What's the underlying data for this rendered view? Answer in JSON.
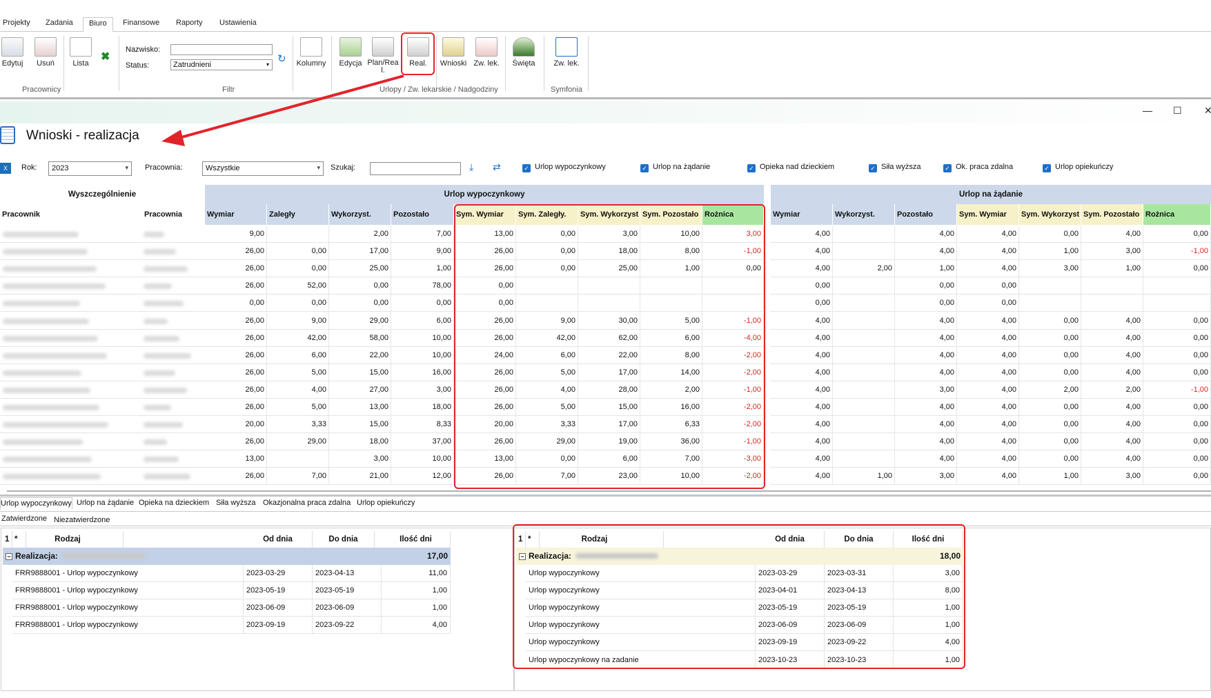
{
  "ribbon": {
    "tabs": [
      "Projekty",
      "Zadania",
      "Biuro",
      "Finansowe",
      "Raporty",
      "Ustawienia"
    ],
    "buttons": {
      "edytuj": "Edytuj",
      "usun": "Usuń",
      "lista": "Lista",
      "kolumny": "Kolumny",
      "edycja": "Edycja",
      "plan": "Plan/Rea l.",
      "real": "Real.",
      "wnioski": "Wnioski",
      "zwlek": "Zw. lek.",
      "swieta": "Święta",
      "zwlek2": "Zw. lek."
    },
    "filters": {
      "nazwisko_label": "Nazwisko:",
      "status_label": "Status:",
      "status_value": "Zatrudnieni",
      "nazwisko_value": ""
    },
    "groups": {
      "pracownicy": "Pracownicy",
      "filtr": "Filtr",
      "urlopy": "Urlopy / Zw. lekarskie / Nadgodziny",
      "symfonia": "Symfonia"
    }
  },
  "window": {
    "title": "Wnioski - realizacja"
  },
  "filterbar": {
    "rok_label": "Rok:",
    "rok_value": "2023",
    "pracownia_label": "Pracownia:",
    "pracownia_value": "Wszystkie",
    "szukaj_label": "Szukaj:",
    "szukaj_value": "",
    "checkboxes": [
      "Urlop wypoczynkowy",
      "Urlop na żądanie",
      "Opieka nad dzieckiem",
      "Siła wyższa",
      "Ok. praca zdalna",
      "Urlop opiekuńczy"
    ]
  },
  "grid": {
    "group_headers": {
      "wyszczegolnienie": "Wyszczególnienie",
      "urlop": "Urlop wypoczynkowy",
      "zadanie": "Urlop na żądanie"
    },
    "columns": {
      "pracownik": "Pracownik",
      "pracownia": "Pracownia",
      "urlop": [
        "Wymiar",
        "Zaległy",
        "Wykorzyst.",
        "Pozostało",
        "Sym. Wymiar",
        "Sym. Zaległy.",
        "Sym. Wykorzyst",
        "Sym. Pozostało",
        "Rożnica"
      ],
      "zadanie": [
        "Wymiar",
        "Wykorzyst.",
        "Pozostało",
        "Sym. Wymiar",
        "Sym. Wykorzyst",
        "Sym. Pozostało",
        "Rożnica"
      ]
    },
    "rows": [
      {
        "u": [
          "9,00",
          "",
          "2,00",
          "7,00",
          "13,00",
          "0,00",
          "3,00",
          "10,00",
          "3,00"
        ],
        "z": [
          "4,00",
          "",
          "4,00",
          "4,00",
          "0,00",
          "4,00",
          "0,00"
        ]
      },
      {
        "u": [
          "26,00",
          "0,00",
          "17,00",
          "9,00",
          "26,00",
          "0,00",
          "18,00",
          "8,00",
          "-1,00"
        ],
        "z": [
          "4,00",
          "",
          "4,00",
          "4,00",
          "1,00",
          "3,00",
          "-1,00"
        ]
      },
      {
        "u": [
          "26,00",
          "0,00",
          "25,00",
          "1,00",
          "26,00",
          "0,00",
          "25,00",
          "1,00",
          "0,00"
        ],
        "z": [
          "4,00",
          "2,00",
          "1,00",
          "4,00",
          "3,00",
          "1,00",
          "0,00"
        ]
      },
      {
        "u": [
          "26,00",
          "52,00",
          "0,00",
          "78,00",
          "0,00",
          "",
          "",
          "",
          ""
        ],
        "z": [
          "0,00",
          "",
          "0,00",
          "0,00",
          "",
          "",
          ""
        ]
      },
      {
        "u": [
          "0,00",
          "0,00",
          "0,00",
          "0,00",
          "0,00",
          "",
          "",
          "",
          ""
        ],
        "z": [
          "0,00",
          "",
          "0,00",
          "0,00",
          "",
          "",
          ""
        ]
      },
      {
        "u": [
          "26,00",
          "9,00",
          "29,00",
          "6,00",
          "26,00",
          "9,00",
          "30,00",
          "5,00",
          "-1,00"
        ],
        "z": [
          "4,00",
          "",
          "4,00",
          "4,00",
          "0,00",
          "4,00",
          "0,00"
        ]
      },
      {
        "u": [
          "26,00",
          "42,00",
          "58,00",
          "10,00",
          "26,00",
          "42,00",
          "62,00",
          "6,00",
          "-4,00"
        ],
        "z": [
          "4,00",
          "",
          "4,00",
          "4,00",
          "0,00",
          "4,00",
          "0,00"
        ]
      },
      {
        "u": [
          "26,00",
          "6,00",
          "22,00",
          "10,00",
          "24,00",
          "6,00",
          "22,00",
          "8,00",
          "-2,00"
        ],
        "z": [
          "4,00",
          "",
          "4,00",
          "4,00",
          "0,00",
          "4,00",
          "0,00"
        ]
      },
      {
        "u": [
          "26,00",
          "5,00",
          "15,00",
          "16,00",
          "26,00",
          "5,00",
          "17,00",
          "14,00",
          "-2,00"
        ],
        "z": [
          "4,00",
          "",
          "4,00",
          "4,00",
          "0,00",
          "4,00",
          "0,00"
        ]
      },
      {
        "u": [
          "26,00",
          "4,00",
          "27,00",
          "3,00",
          "26,00",
          "4,00",
          "28,00",
          "2,00",
          "-1,00"
        ],
        "z": [
          "4,00",
          "",
          "3,00",
          "4,00",
          "2,00",
          "2,00",
          "-1,00"
        ]
      },
      {
        "u": [
          "26,00",
          "5,00",
          "13,00",
          "18,00",
          "26,00",
          "5,00",
          "15,00",
          "16,00",
          "-2,00"
        ],
        "z": [
          "4,00",
          "",
          "4,00",
          "4,00",
          "0,00",
          "4,00",
          "0,00"
        ]
      },
      {
        "u": [
          "20,00",
          "3,33",
          "15,00",
          "8,33",
          "20,00",
          "3,33",
          "17,00",
          "6,33",
          "-2,00"
        ],
        "z": [
          "4,00",
          "",
          "4,00",
          "4,00",
          "0,00",
          "4,00",
          "0,00"
        ]
      },
      {
        "u": [
          "26,00",
          "29,00",
          "18,00",
          "37,00",
          "26,00",
          "29,00",
          "19,00",
          "36,00",
          "-1,00"
        ],
        "z": [
          "4,00",
          "",
          "4,00",
          "4,00",
          "0,00",
          "4,00",
          "0,00"
        ]
      },
      {
        "u": [
          "13,00",
          "",
          "3,00",
          "10,00",
          "13,00",
          "0,00",
          "6,00",
          "7,00",
          "-3,00"
        ],
        "z": [
          "4,00",
          "",
          "4,00",
          "4,00",
          "0,00",
          "4,00",
          "0,00"
        ]
      },
      {
        "u": [
          "26,00",
          "7,00",
          "21,00",
          "12,00",
          "26,00",
          "7,00",
          "23,00",
          "10,00",
          "-2,00"
        ],
        "z": [
          "4,00",
          "1,00",
          "3,00",
          "4,00",
          "1,00",
          "3,00",
          "0,00"
        ]
      }
    ]
  },
  "bottom_tabs": [
    "Urlop wypoczynkowy",
    "Urlop na żądanie",
    "Opieka na dzieckiem",
    "Siła wyższa",
    "Okazjonalna praca zdalna",
    "Urlop opiekuńczy"
  ],
  "sub_tabs": [
    "Zatwierdzone",
    "Niezatwierdzone"
  ],
  "left_table": {
    "headers": [
      "1",
      "*",
      "Rodzaj",
      "Od dnia",
      "Do dnia",
      "Ilość dni"
    ],
    "group_label": "Realizacja:",
    "group_total": "17,00",
    "rows": [
      [
        "FRR9888001 - Urlop wypoczynkowy",
        "2023-03-29",
        "2023-04-13",
        "11,00"
      ],
      [
        "FRR9888001 - Urlop wypoczynkowy",
        "2023-05-19",
        "2023-05-19",
        "1,00"
      ],
      [
        "FRR9888001 - Urlop wypoczynkowy",
        "2023-06-09",
        "2023-06-09",
        "1,00"
      ],
      [
        "FRR9888001 - Urlop wypoczynkowy",
        "2023-09-19",
        "2023-09-22",
        "4,00"
      ]
    ]
  },
  "right_table": {
    "headers": [
      "1",
      "*",
      "Rodzaj",
      "Od dnia",
      "Do dnia",
      "Ilość dni"
    ],
    "group_label": "Realizacja:",
    "group_total": "18,00",
    "rows": [
      [
        "Urlop wypoczynkowy",
        "2023-03-29",
        "2023-03-31",
        "3,00"
      ],
      [
        "Urlop wypoczynkowy",
        "2023-04-01",
        "2023-04-13",
        "8,00"
      ],
      [
        "Urlop wypoczynkowy",
        "2023-05-19",
        "2023-05-19",
        "1,00"
      ],
      [
        "Urlop wypoczynkowy",
        "2023-06-09",
        "2023-06-09",
        "1,00"
      ],
      [
        "Urlop wypoczynkowy",
        "2023-09-19",
        "2023-09-22",
        "4,00"
      ],
      [
        "Urlop wypoczynkowy na zadanie",
        "2023-10-23",
        "2023-10-23",
        "1,00"
      ]
    ]
  },
  "colors": {
    "header_blue": "#cdd9ea",
    "sym_yellow": "#f6f1c8",
    "diff_green": "#a8e6a0",
    "negative": "#e02020",
    "highlight_red": "#e3232a"
  }
}
